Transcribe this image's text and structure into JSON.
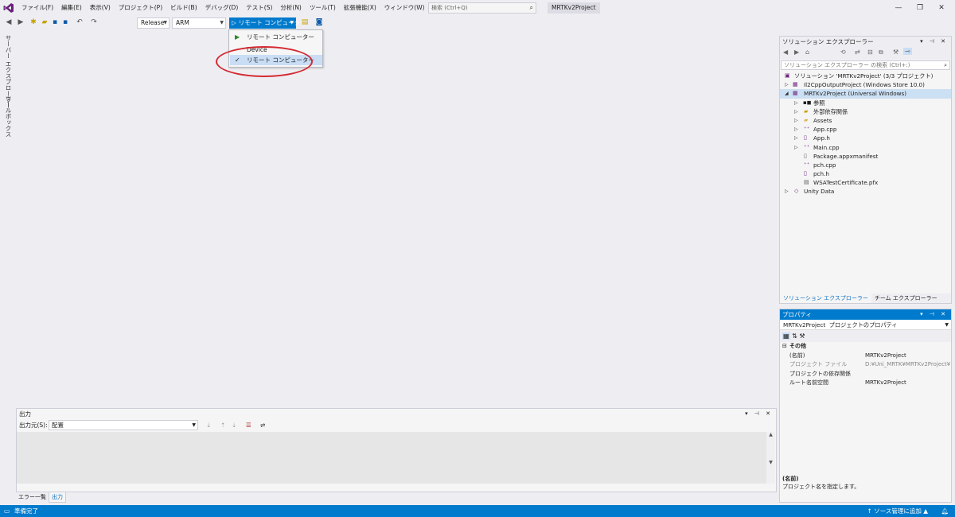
{
  "menu": {
    "items": [
      "ファイル(F)",
      "編集(E)",
      "表示(V)",
      "プロジェクト(P)",
      "ビルド(B)",
      "デバッグ(D)",
      "テスト(S)",
      "分析(N)",
      "ツール(T)",
      "拡張機能(X)",
      "ウィンドウ(W)",
      "ヘルプ(H)"
    ],
    "search_placeholder": "検索 (Ctrl+Q)",
    "project_name": "MRTKv2Project"
  },
  "toolbar": {
    "config": "Release",
    "platform": "ARM",
    "run_target": "リモート コンピューター"
  },
  "left_tabs": [
    "サーバー エクスプローラー",
    "ツールボックス"
  ],
  "dropdown": {
    "items": [
      {
        "label": "リモート コンピューター",
        "mark": "▶"
      },
      {
        "label": "Device",
        "mark": ""
      },
      {
        "label": "リモート コンピューター",
        "mark": "✓"
      }
    ]
  },
  "solution_explorer": {
    "title": "ソリューション エクスプローラー",
    "search_placeholder": "ソリューション エクスプローラー の検索 (Ctrl+:)",
    "tree": [
      {
        "label": "ソリューション 'MRTKv2Project' (3/3 プロジェクト)",
        "icon": "solution-icon"
      },
      {
        "label": "Il2CppOutputProject (Windows Store 10.0)",
        "icon": "cpp-project-icon"
      },
      {
        "label": "MRTKv2Project (Universal Windows)",
        "icon": "cpp-project-icon"
      },
      {
        "label": "参照",
        "icon": "references-icon"
      },
      {
        "label": "外部依存関係",
        "icon": "external-deps-icon"
      },
      {
        "label": "Assets",
        "icon": "folder-icon"
      },
      {
        "label": "App.cpp",
        "icon": "cpp-file-icon"
      },
      {
        "label": "App.h",
        "icon": "header-file-icon"
      },
      {
        "label": "Main.cpp",
        "icon": "cpp-file-icon"
      },
      {
        "label": "Package.appxmanifest",
        "icon": "manifest-icon"
      },
      {
        "label": "pch.cpp",
        "icon": "cpp-file-icon"
      },
      {
        "label": "pch.h",
        "icon": "header-file-icon"
      },
      {
        "label": "WSATestCertificate.pfx",
        "icon": "certificate-icon"
      },
      {
        "label": "Unity Data",
        "icon": "project-icon"
      }
    ],
    "tabs": [
      "ソリューション エクスプローラー",
      "チーム エクスプローラー"
    ]
  },
  "properties": {
    "title": "プロパティ",
    "object_name": "MRTKv2Project",
    "object_desc": "プロジェクトのプロパティ",
    "category": "その他",
    "rows": [
      {
        "key": "(名前)",
        "value": "MRTKv2Project"
      },
      {
        "key": "プロジェクト ファイル",
        "value": "D:¥Uni_MRTK¥MRTKv2Project¥Ap"
      },
      {
        "key": "プロジェクトの依存関係",
        "value": ""
      },
      {
        "key": "ルート名前空間",
        "value": "MRTKv2Project"
      }
    ],
    "desc_title": "(名前)",
    "desc_text": "プロジェクト名を指定します。"
  },
  "output": {
    "title": "出力",
    "source_label": "出力元(S):",
    "source_value": "配置",
    "tabs": [
      "エラー一覧",
      "出力"
    ]
  },
  "status": {
    "text": "準備完了",
    "source_control": "↑ ソース管理に追加 ▲"
  },
  "colors": {
    "accent": "#007acc",
    "highlight": "#d42a32"
  }
}
